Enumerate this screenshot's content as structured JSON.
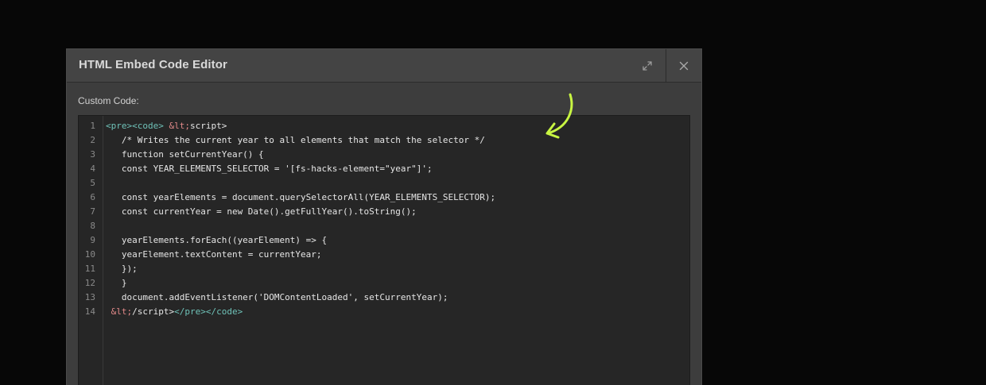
{
  "modal": {
    "title": "HTML Embed Code Editor",
    "expand_icon": "expand-icon",
    "close_icon": "close-icon"
  },
  "field": {
    "label": "Custom Code:"
  },
  "editor": {
    "line_numbers": [
      "1",
      "2",
      "3",
      "4",
      "5",
      "6",
      "7",
      "8",
      "9",
      "10",
      "11",
      "12",
      "13",
      "14"
    ],
    "lines": [
      [
        {
          "t": "tag",
          "v": "<pre><code>"
        },
        {
          "t": "plain",
          "v": " "
        },
        {
          "t": "entity",
          "v": "&lt;"
        },
        {
          "t": "plain",
          "v": "script>"
        }
      ],
      [
        {
          "t": "plain",
          "v": "   /* Writes the current year to all elements that match the selector */"
        }
      ],
      [
        {
          "t": "plain",
          "v": "   function setCurrentYear() {"
        }
      ],
      [
        {
          "t": "plain",
          "v": "   const YEAR_ELEMENTS_SELECTOR = '[fs-hacks-element=\"year\"]';"
        }
      ],
      [
        {
          "t": "plain",
          "v": ""
        }
      ],
      [
        {
          "t": "plain",
          "v": "   const yearElements = document.querySelectorAll(YEAR_ELEMENTS_SELECTOR);"
        }
      ],
      [
        {
          "t": "plain",
          "v": "   const currentYear = new Date().getFullYear().toString();"
        }
      ],
      [
        {
          "t": "plain",
          "v": ""
        }
      ],
      [
        {
          "t": "plain",
          "v": "   yearElements.forEach((yearElement) => {"
        }
      ],
      [
        {
          "t": "plain",
          "v": "   yearElement.textContent = currentYear;"
        }
      ],
      [
        {
          "t": "plain",
          "v": "   });"
        }
      ],
      [
        {
          "t": "plain",
          "v": "   }"
        }
      ],
      [
        {
          "t": "plain",
          "v": "   document.addEventListener('DOMContentLoaded', setCurrentYear);"
        }
      ],
      [
        {
          "t": "plain",
          "v": " "
        },
        {
          "t": "entity",
          "v": "&lt;"
        },
        {
          "t": "plain",
          "v": "/script>"
        },
        {
          "t": "tag",
          "v": "</pre></code>"
        }
      ]
    ]
  },
  "annotation": {
    "arrow_icon": "hand-drawn-arrow-icon",
    "arrow_color": "#c8f542"
  },
  "colors": {
    "background": "#070707",
    "modal_bg": "#3d3d3d",
    "editor_bg": "#262626",
    "tag_color": "#6fc2b8",
    "entity_color": "#e38a8a"
  }
}
